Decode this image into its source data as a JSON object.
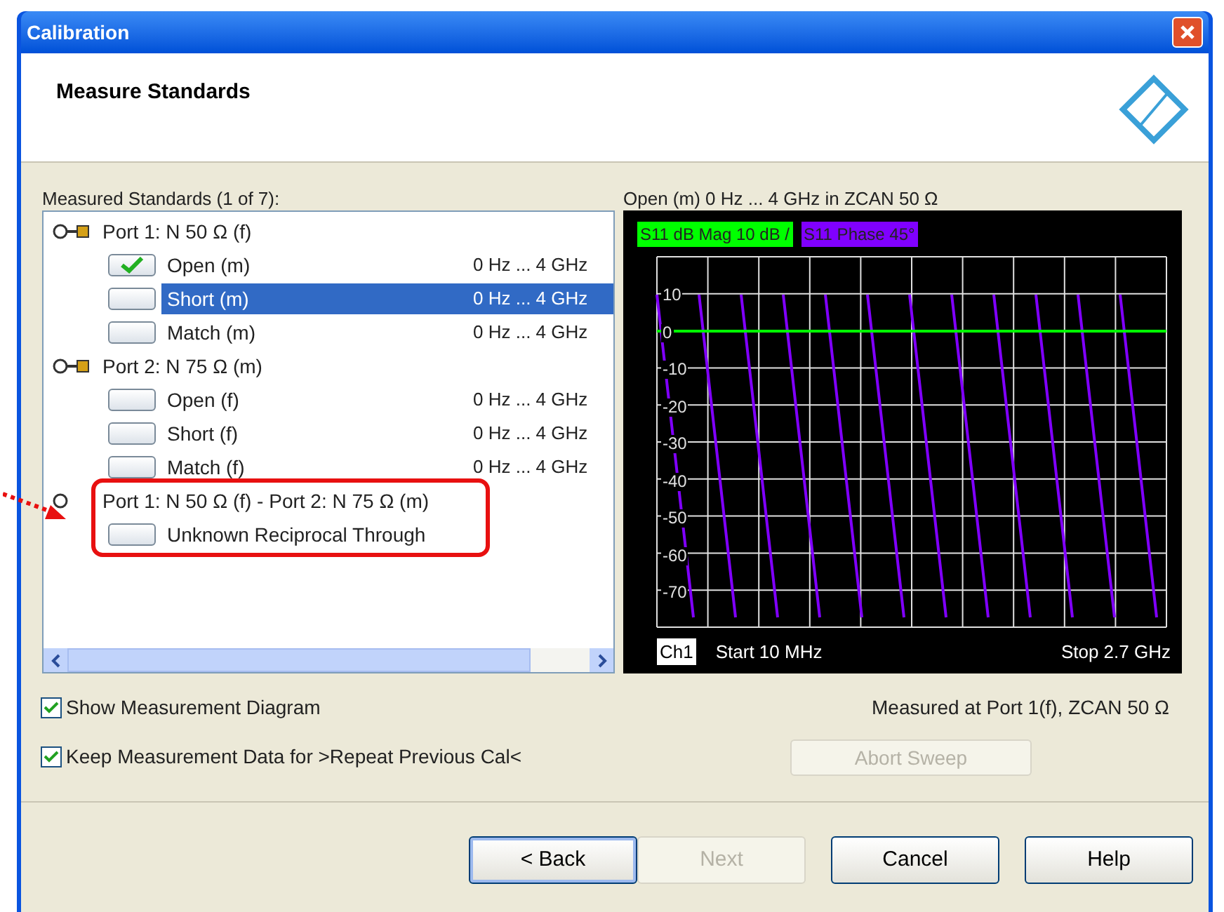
{
  "window": {
    "title": "Calibration"
  },
  "header": {
    "title": "Measure Standards"
  },
  "standards": {
    "label": "Measured Standards (1 of 7):",
    "groups": [
      {
        "label": "Port 1: N 50 Ω (f)",
        "children": [
          {
            "label": "Open (m)",
            "range": "0 Hz ... 4 GHz",
            "checked": true,
            "selected": false
          },
          {
            "label": "Short (m)",
            "range": "0 Hz ... 4 GHz",
            "checked": false,
            "selected": true
          },
          {
            "label": "Match (m)",
            "range": "0 Hz ... 4 GHz",
            "checked": false,
            "selected": false
          }
        ]
      },
      {
        "label": "Port 2: N 75 Ω (m)",
        "children": [
          {
            "label": "Open (f)",
            "range": "0 Hz ... 4 GHz",
            "checked": false,
            "selected": false
          },
          {
            "label": "Short (f)",
            "range": "0 Hz ... 4 GHz",
            "checked": false,
            "selected": false
          },
          {
            "label": "Match (f)",
            "range": "0 Hz ... 4 GHz",
            "checked": false,
            "selected": false
          }
        ]
      },
      {
        "label": "Port 1: N 50 Ω (f) - Port 2: N 75 Ω (m)",
        "highlighted": true,
        "children": [
          {
            "label": "Unknown Reciprocal Through",
            "checked": false,
            "selected": false
          }
        ]
      }
    ]
  },
  "diagram": {
    "title": "Open  (m) 0 Hz ... 4 GHz in ZCAN 50 Ω",
    "traces": [
      {
        "label": "S11 dB Mag 10 dB /",
        "color": "#00ff00"
      },
      {
        "label": "S11 Phase 45°",
        "color": "#8000ff"
      }
    ],
    "y_ticks": [
      "10",
      "0",
      "-10",
      "-20",
      "-30",
      "-40",
      "-50",
      "-60",
      "-70"
    ],
    "channel": "Ch1",
    "start": "Start 10 MHz",
    "stop": "Stop 2.7 GHz"
  },
  "options": [
    {
      "label": "Show Measurement Diagram",
      "checked": true
    },
    {
      "label": "Keep Measurement Data for >Repeat Previous Cal<",
      "checked": true
    }
  ],
  "measured_at": "Measured at Port 1(f), ZCAN 50 Ω",
  "abort_button": {
    "label": "Abort Sweep",
    "disabled": true
  },
  "buttons": [
    {
      "label": "< Back",
      "disabled": false,
      "default": true
    },
    {
      "label": "Next",
      "disabled": true,
      "default": false
    },
    {
      "label": "Cancel",
      "disabled": false,
      "default": false
    },
    {
      "label": "Help",
      "disabled": false,
      "default": false
    }
  ]
}
